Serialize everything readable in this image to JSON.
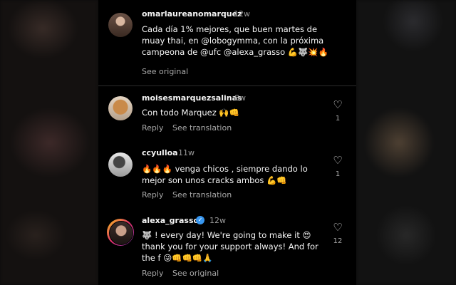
{
  "comments": [
    {
      "username": "omarlaureanomarquez",
      "time": "12w",
      "text": "Cada día 1% mejores, que buen martes de\nmuay thai, en @lobogymma, con la próxima\ncampeona de @ufc @alexa_grasso 💪🐺💥🔥",
      "actions": [
        "See original"
      ]
    },
    {
      "username": "moisesmarquezsalinas",
      "time": "8w",
      "text": "Con todo Marquez 🙌👊",
      "actions": [
        "Reply",
        "See translation"
      ],
      "likes": "1"
    },
    {
      "username": "ccyulloa",
      "time": "11w",
      "text": "🔥🔥🔥 venga chicos , siempre dando lo\nmejor son unos cracks ambos 💪👊",
      "actions": [
        "Reply",
        "See translation"
      ],
      "likes": "1"
    },
    {
      "username": "alexa_grasso",
      "time": "12w",
      "text": "🐺 ! every day! We're going to make it 😍\nthank you for your support always! And for\nthe f      😜👊👊👊🙏",
      "actions": [
        "Reply",
        "See original"
      ],
      "likes": "12",
      "verified": true
    }
  ],
  "icons": {
    "heart": "heart-outline-icon",
    "verified": "verified-badge-icon"
  },
  "colors": {
    "background": "#000000",
    "secondary_text": "#a8a8a8",
    "verified": "#3897f0"
  }
}
